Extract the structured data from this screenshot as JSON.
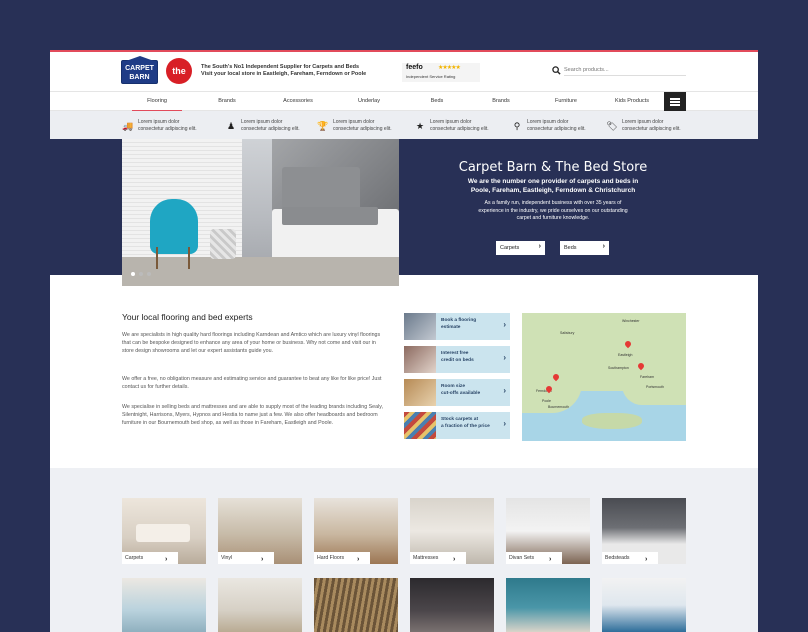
{
  "header": {
    "logo_carpet": "CARPET BARN",
    "logo_bed": "the bed",
    "tagline_1": "The South's No1 Independent Supplier for Carpets and Beds",
    "tagline_2": "Visit your local store in Eastleigh, Fareham, Ferndown or Poole",
    "feefo_logo": "feefo",
    "feefo_sub": "Independent Service Rating",
    "search_placeholder": "Search products..."
  },
  "nav": {
    "items": [
      "Flooring",
      "Brands",
      "Accessories",
      "Underlay",
      "Beds",
      "Brands",
      "Furniture",
      "Kids Products"
    ],
    "active_index": 0
  },
  "usp": [
    {
      "icon": "truck-icon",
      "line1": "Lorem ipsum dolor",
      "line2": "consectetur adipiscing elit."
    },
    {
      "icon": "person-icon",
      "line1": "Lorem ipsum dolor",
      "line2": "consectetur adipiscing elit."
    },
    {
      "icon": "trophy-icon",
      "line1": "Lorem ipsum dolor",
      "line2": "consectetur adipiscing elit."
    },
    {
      "icon": "star-icon",
      "line1": "Lorem ipsum dolor",
      "line2": "consectetur adipiscing elit."
    },
    {
      "icon": "location-pin-icon",
      "line1": "Lorem ipsum dolor",
      "line2": "consectetur adipiscing elit."
    },
    {
      "icon": "tag-icon",
      "line1": "Lorem ipsum dolor",
      "line2": "consectetur adipiscing elit."
    }
  ],
  "hero": {
    "title": "Carpet Barn & The Bed Store",
    "subtitle_1": "We are the number one provider of carpets and beds in",
    "subtitle_2": "Poole, Fareham, Eastleigh, Ferndown & Christchurch",
    "desc_1": "As a family run, independent business with over 35 years of",
    "desc_2": "experience in the industry, we pride ourselves on our outstanding",
    "desc_3": "carpet and furniture knowledge.",
    "btn_carpets": "Carpets",
    "btn_beds": "Beds",
    "carousel_dots": 3,
    "active_dot": 0
  },
  "intro": {
    "heading": "Your local flooring and bed experts",
    "p1": "We are specialists in high quality hard floorings including Karndean and Amtico which are luxury vinyl floorings that can be bespoke designed to enhance any area of your home or business. Why not come and visit our in store design showrooms and let our expert assistants guide you.",
    "p2": "We offer a free, no obligation measure and estimating service and guarantee to beat any like for like price! Just contact us for further details.",
    "p3": "We specialise in selling beds and mattresses and are able to supply most of the leading brands including Sealy, Silentnight, Harrisons, Myers, Hypnos and Hestia to name just a few. We also offer headboards and bedroom furniture in our Bournemouth bed shop, as well as those in Fareham, Eastleigh and Poole."
  },
  "ctas": [
    {
      "line1": "Book a flooring",
      "line2": "estimate"
    },
    {
      "line1": "Interest free",
      "line2": "credit on beds"
    },
    {
      "line1": "Room size",
      "line2": "cut-offs available"
    },
    {
      "line1": "Stock carpets at",
      "line2": "a fraction of the price"
    }
  ],
  "map": {
    "labels": [
      "Salisbury",
      "Winchester",
      "Eastleigh",
      "Southampton",
      "Fareham",
      "Portsmouth",
      "Bournemouth",
      "Ferndown",
      "Poole"
    ]
  },
  "categories": [
    "Carpets",
    "Vinyl",
    "Hard Floors",
    "Mattresses",
    "Divan Sets",
    "Bedsteads"
  ],
  "colors": {
    "page_bg": "#283056",
    "hero_bg": "#283056",
    "accent": "#e24b5b",
    "cta_bg": "#cbe4ee"
  }
}
